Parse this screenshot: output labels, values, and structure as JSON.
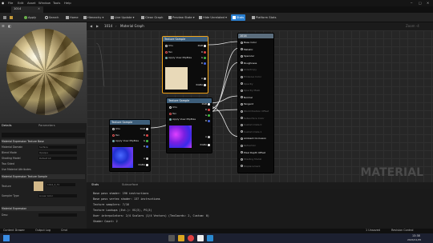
{
  "menu": [
    "File",
    "Edit",
    "Asset",
    "Window",
    "Tools",
    "Help"
  ],
  "tab_title": "1014",
  "toolbar": {
    "apply": "Apply",
    "search": "Search",
    "home": "Home",
    "hierarchy": "Hierarchy",
    "live_update": "Live Update",
    "clean_graph": "Clean Graph",
    "preview_state": "Preview State",
    "hide_unrelated": "Hide Unrelated",
    "stats": "Stats",
    "platform_stats": "Platform Stats"
  },
  "breadcrumb": {
    "asset": "1014",
    "graph": "Material Graph",
    "zoom": "Zoom -4"
  },
  "panels": {
    "details": "Details",
    "parameters": "Parameters"
  },
  "details": {
    "material_expr": "Material Expression Texture Base",
    "rows": [
      {
        "label": "Material Domain",
        "value": "Surface"
      },
      {
        "label": "Blend Mode",
        "value": "Opaque"
      },
      {
        "label": "Shading Model",
        "value": "Default Lit"
      },
      {
        "label": "Two Sided",
        "value": ""
      },
      {
        "label": "Use Material Attributes",
        "value": ""
      }
    ],
    "texture_section": "Material Expression Texture Sample",
    "texture_label": "Texture",
    "texture_value": "1014_3_T1",
    "sampler_label": "Sampler Type",
    "sampler_value": "Linear Color",
    "misc_section": "Material Expression",
    "desc_label": "Desc"
  },
  "nodes": [
    {
      "title": "Texture Sample",
      "uvs": "UVs",
      "tex": "Tex",
      "mip": "Apply View MipBias"
    },
    {
      "title": "Texture Sample",
      "uvs": "UVs",
      "tex": "Tex",
      "mip": "Apply View MipBias"
    },
    {
      "title": "Texture Sample",
      "uvs": "UVs",
      "tex": "Tex",
      "mip": "Apply View MipBias"
    }
  ],
  "node_outputs": [
    "RGB",
    "R",
    "G",
    "B",
    "A",
    "RGBA"
  ],
  "material_node": {
    "title": "1014",
    "pins": [
      "Base Color",
      "Metallic",
      "Specular",
      "Roughness",
      "Anisotropy",
      "Emissive Color",
      "Opacity",
      "Opacity Mask",
      "Normal",
      "Tangent",
      "World Position Offset",
      "Subsurface Color",
      "Custom Data 0",
      "Custom Data 1",
      "Ambient Occlusion",
      "Refraction",
      "Pixel Depth Offset",
      "Shading Model",
      "Displacement"
    ]
  },
  "watermark": "MATERIAL",
  "stats_tabs": [
    "Stats",
    "Subsurface"
  ],
  "stats": [
    "Base pass shader: 196 instructions",
    "Base pass vertex shader: 137 instructions",
    "Texture samplers: 7/16",
    "Texture Lookups (Est.): VS(3), PS(3)",
    "User interpolators: 2/4 Scalars (1/4 Vectors) (TexCoords: 2, Custom: 0)",
    "Shader Count: 2"
  ],
  "bottom": {
    "content_browser": "Content Drawer",
    "output_log": "Output Log",
    "cmd": "Cmd",
    "unsaved": "1 Unsaved",
    "revision": "Revision Control"
  },
  "clock": {
    "time": "13:38",
    "date": "2024/11/25"
  }
}
